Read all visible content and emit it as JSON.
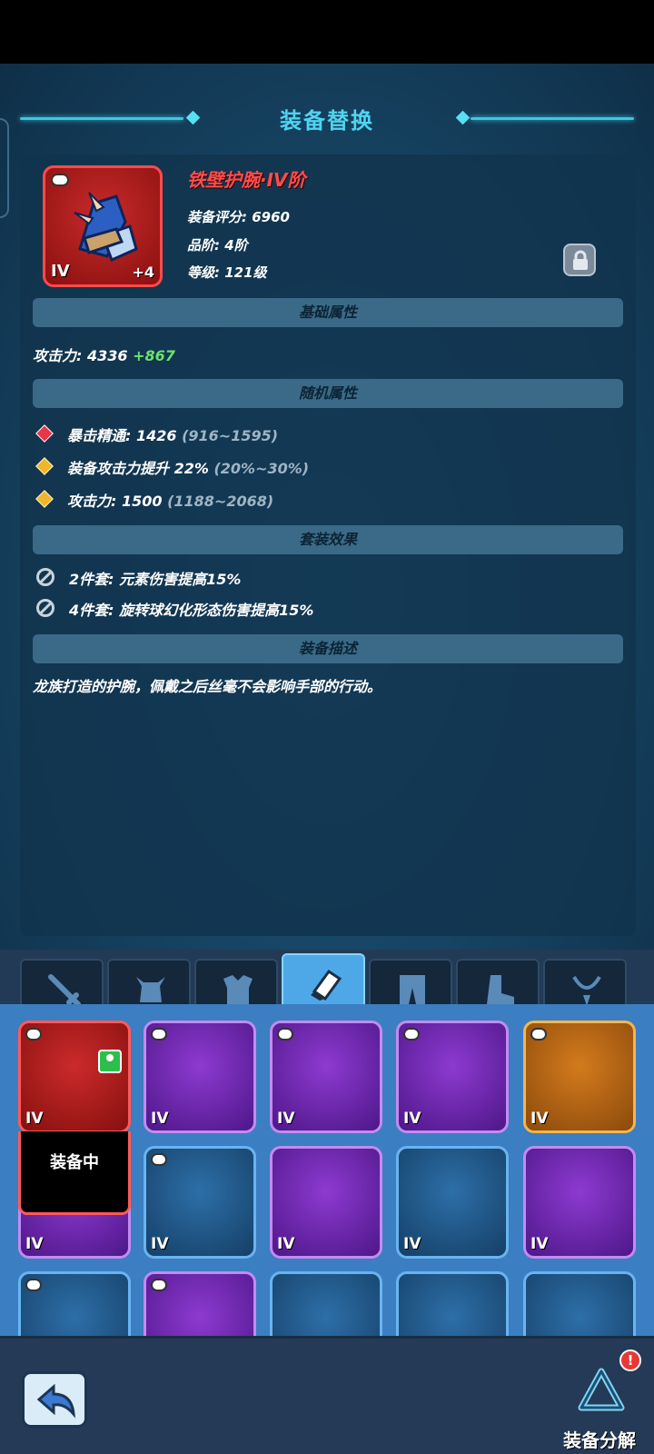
{
  "window": {
    "title": "装备替换"
  },
  "item": {
    "name": "铁壁护腕·IV阶",
    "tier_badge": "IV",
    "plus_level": "+4",
    "score_label": "装备评分: 6960",
    "quality_label": "品阶: 4阶",
    "level_label": "等级: 121级",
    "rarity_color": "#ff4a4a"
  },
  "sections": {
    "base_attrs": "基础属性",
    "random_attrs": "随机属性",
    "set_effects": "套装效果",
    "description": "装备描述"
  },
  "base_attrs": {
    "attack_label": "攻击力: 4336",
    "attack_bonus": "+867"
  },
  "random_attrs": [
    {
      "icon": "red-gem-icon",
      "label": "暴击精通: 1426",
      "range": "(916~1595)"
    },
    {
      "icon": "gold-gem-icon",
      "label": "装备攻击力提升 22%",
      "range": "(20%~30%)"
    },
    {
      "icon": "gold-gem-icon",
      "label": "攻击力: 1500",
      "range": "(1188~2068)"
    }
  ],
  "set_effects": [
    {
      "icon": "ban-icon",
      "label": "2件套: 元素伤害提高15%"
    },
    {
      "icon": "ban-icon",
      "label": "4件套: 旋转球幻化形态伤害提高15%"
    }
  ],
  "description_text": "龙族打造的护腕，佩戴之后丝毫不会影响手部的行动。",
  "tabs": [
    "sword-icon",
    "helmet-icon",
    "armor-icon",
    "bracer-icon",
    "pants-icon",
    "boots-icon",
    "necklace-icon"
  ],
  "active_tab": "bracer-icon",
  "inventory": {
    "equipped_label": "装备中",
    "tier": "IV"
  },
  "bottom": {
    "decompose_label": "装备分解",
    "alert": "!"
  }
}
